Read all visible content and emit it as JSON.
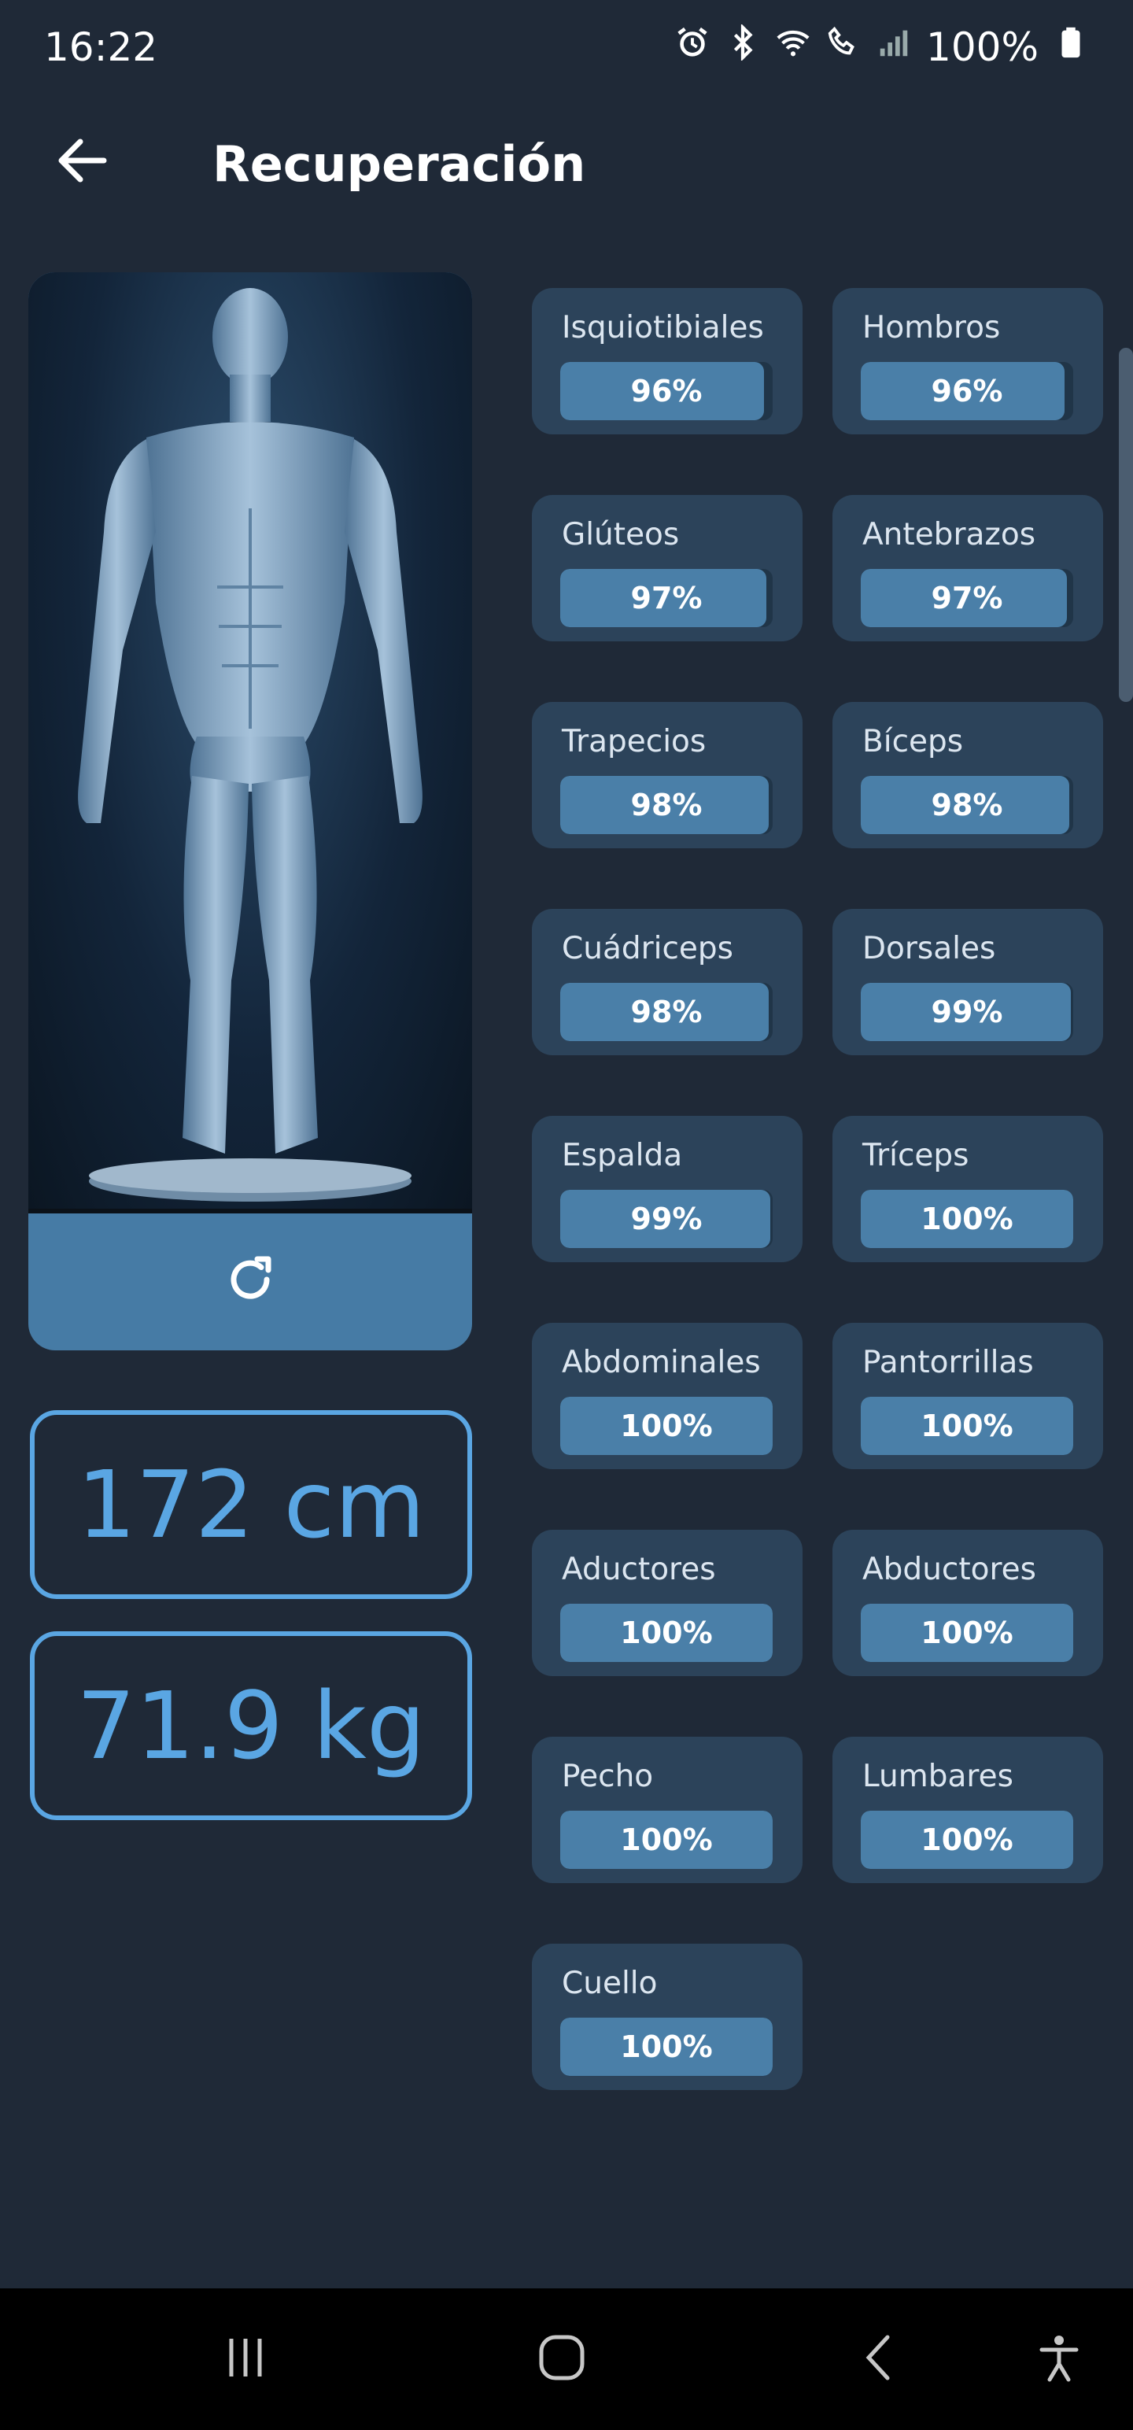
{
  "status_bar": {
    "time": "16:22",
    "battery": "100%",
    "icons": [
      "alarm-icon",
      "bluetooth-icon",
      "wifi-icon",
      "wifi-call-icon",
      "signal-icon",
      "battery-icon"
    ]
  },
  "header": {
    "title": "Recuperación",
    "back_icon": "arrow-left-icon"
  },
  "body_panel": {
    "refresh_icon": "refresh-icon"
  },
  "stats": {
    "height": "172 cm",
    "weight": "71.9 kg"
  },
  "muscles": [
    {
      "name": "Isquiotibiales",
      "percent": "96%",
      "value": 96
    },
    {
      "name": "Hombros",
      "percent": "96%",
      "value": 96
    },
    {
      "name": "Glúteos",
      "percent": "97%",
      "value": 97
    },
    {
      "name": "Antebrazos",
      "percent": "97%",
      "value": 97
    },
    {
      "name": "Trapecios",
      "percent": "98%",
      "value": 98
    },
    {
      "name": "Bíceps",
      "percent": "98%",
      "value": 98
    },
    {
      "name": "Cuádriceps",
      "percent": "98%",
      "value": 98
    },
    {
      "name": "Dorsales",
      "percent": "99%",
      "value": 99
    },
    {
      "name": "Espalda",
      "percent": "99%",
      "value": 99
    },
    {
      "name": "Tríceps",
      "percent": "100%",
      "value": 100
    },
    {
      "name": "Abdominales",
      "percent": "100%",
      "value": 100
    },
    {
      "name": "Pantorrillas",
      "percent": "100%",
      "value": 100
    },
    {
      "name": "Aductores",
      "percent": "100%",
      "value": 100
    },
    {
      "name": "Abductores",
      "percent": "100%",
      "value": 100
    },
    {
      "name": "Pecho",
      "percent": "100%",
      "value": 100
    },
    {
      "name": "Lumbares",
      "percent": "100%",
      "value": 100
    },
    {
      "name": "Cuello",
      "percent": "100%",
      "value": 100
    }
  ],
  "nav_bar": {
    "icons": [
      "recents-icon",
      "home-icon",
      "back-icon",
      "accessibility-icon"
    ]
  },
  "colors": {
    "background": "#1f2937",
    "card": "#2c435a",
    "accent": "#5aa6e3",
    "bar_fill": "#4a7fa8"
  }
}
